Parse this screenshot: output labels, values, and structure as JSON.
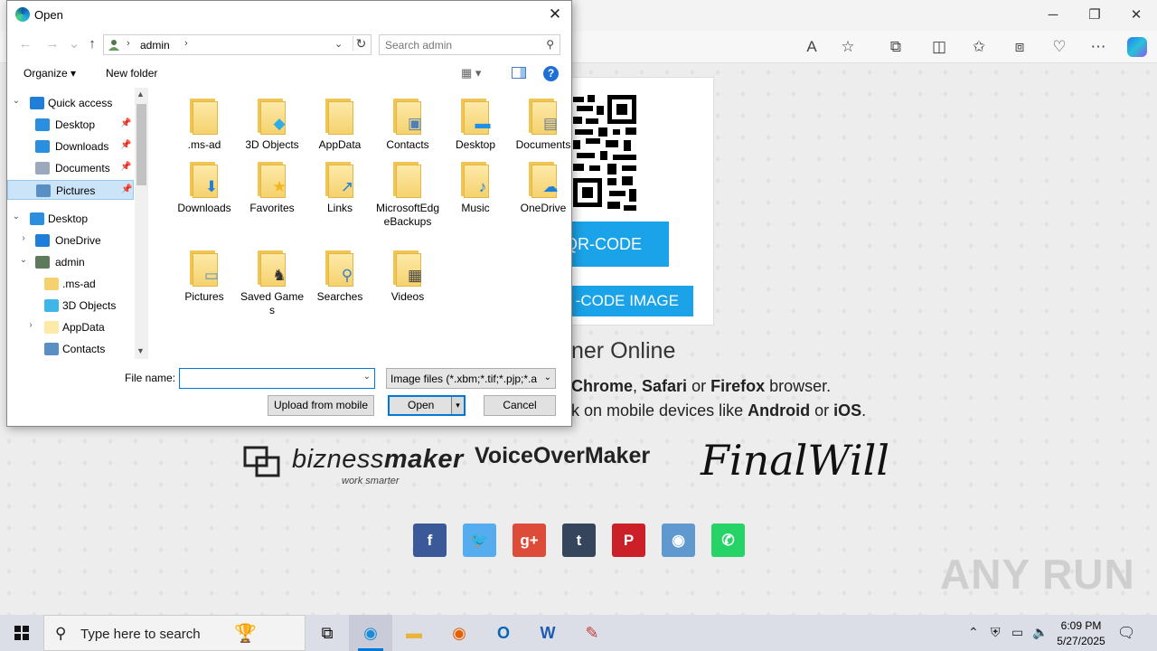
{
  "browser": {
    "window_controls": {
      "minimize": "─",
      "restore": "❐",
      "close": "✕"
    },
    "page": {
      "qr_button": "QR-CODE",
      "qr_image_button": "-CODE IMAGE",
      "headline": "ner Online",
      "para1": {
        "a": "Chrome",
        "b": ", ",
        "c": "Safari",
        "d": " or ",
        "e": "Firefox",
        "f": " browser."
      },
      "para2": {
        "a": "k on mobile devices like ",
        "b": "Android",
        "c": " or ",
        "d": "iOS",
        "e": "."
      },
      "logos": {
        "biznessmaker_a": "bizness",
        "biznessmaker_b": "maker",
        "biznessmaker_sub": "work smarter",
        "voiceovermaker": "VoiceOverMaker",
        "finalwill": "FinalWill"
      },
      "social": [
        {
          "name": "facebook",
          "glyph": "f",
          "color": "#3b5998"
        },
        {
          "name": "twitter",
          "glyph": "🐦",
          "color": "#55acee"
        },
        {
          "name": "google-plus",
          "glyph": "g+",
          "color": "#dd4b39"
        },
        {
          "name": "tumblr",
          "glyph": "t",
          "color": "#35465c"
        },
        {
          "name": "pinterest",
          "glyph": "P",
          "color": "#cb2027"
        },
        {
          "name": "reddit",
          "glyph": "◉",
          "color": "#5f99cf"
        },
        {
          "name": "whatsapp",
          "glyph": "✆",
          "color": "#25d366"
        }
      ]
    },
    "watermark": "ANY RUN"
  },
  "dialog": {
    "title": "Open",
    "address": {
      "segment": "admin"
    },
    "search_placeholder": "Search admin",
    "organize": "Organize ▾",
    "new_folder": "New folder",
    "help": "?",
    "tree": [
      {
        "label": "Quick access",
        "icon": "star-icon",
        "color": "#1e7fd8",
        "arrow": "⌄"
      },
      {
        "label": "Desktop",
        "icon": "desktop-icon",
        "color": "#2b8fe0",
        "pinned": true
      },
      {
        "label": "Downloads",
        "icon": "download-icon",
        "color": "#2b8fe0",
        "pinned": true
      },
      {
        "label": "Documents",
        "icon": "document-icon",
        "color": "#9aa9bb",
        "pinned": true
      },
      {
        "label": "Pictures",
        "icon": "pictures-icon",
        "color": "#5a8fc4",
        "pinned": true,
        "selected": true
      },
      {
        "label": "Desktop",
        "icon": "desktop-icon",
        "color": "#2b8fe0",
        "arrow": "⌄"
      },
      {
        "label": "OneDrive",
        "icon": "onedrive-icon",
        "color": "#1e7fd8",
        "arrow": "›"
      },
      {
        "label": "admin",
        "icon": "user-icon",
        "color": "#5d7a5a",
        "arrow": "⌄"
      },
      {
        "label": ".ms-ad",
        "icon": "folder-icon",
        "color": "#f5d26e"
      },
      {
        "label": "3D Objects",
        "icon": "3d-objects-icon",
        "color": "#3fb6e8"
      },
      {
        "label": "AppData",
        "icon": "folder-icon",
        "color": "#fde9a8",
        "arrow": "›"
      },
      {
        "label": "Contacts",
        "icon": "contacts-icon",
        "color": "#5a8fc4"
      }
    ],
    "files": [
      {
        "label": ".ms-ad",
        "badge": "",
        "badge_name": "folder-icon"
      },
      {
        "label": "3D Objects",
        "badge": "◆",
        "badge_name": "3d-objects-icon",
        "badge_color": "#2eaee6"
      },
      {
        "label": "AppData",
        "badge": "",
        "badge_name": "folder-icon"
      },
      {
        "label": "Contacts",
        "badge": "▣",
        "badge_name": "contacts-icon",
        "badge_color": "#4e7fb8"
      },
      {
        "label": "Desktop",
        "badge": "▬",
        "badge_name": "desktop-icon",
        "badge_color": "#1e90e6"
      },
      {
        "label": "Documents",
        "badge": "▤",
        "badge_name": "document-icon",
        "badge_color": "#6f7f92"
      },
      {
        "label": "Downloads",
        "badge": "⬇",
        "badge_name": "download-icon",
        "badge_color": "#1e7fd8"
      },
      {
        "label": "Favorites",
        "badge": "★",
        "badge_name": "star-icon",
        "badge_color": "#f2b51d"
      },
      {
        "label": "Links",
        "badge": "↗",
        "badge_name": "link-icon",
        "badge_color": "#1e7fd8"
      },
      {
        "label": "MicrosoftEdgeBackups",
        "badge": "",
        "badge_name": "folder-icon"
      },
      {
        "label": "Music",
        "badge": "♪",
        "badge_name": "music-icon",
        "badge_color": "#1e7fd8"
      },
      {
        "label": "OneDrive",
        "badge": "☁",
        "badge_name": "onedrive-icon",
        "badge_color": "#1e7fd8"
      },
      {
        "label": "Pictures",
        "badge": "▭",
        "badge_name": "pictures-icon",
        "badge_color": "#5a8fc4"
      },
      {
        "label": "Saved Games",
        "badge": "♞",
        "badge_name": "chess-icon",
        "badge_color": "#333333"
      },
      {
        "label": "Searches",
        "badge": "⚲",
        "badge_name": "search-icon",
        "badge_color": "#3b7fc9"
      },
      {
        "label": "Videos",
        "badge": "▦",
        "badge_name": "video-icon",
        "badge_color": "#444444"
      }
    ],
    "file_name_label": "File name:",
    "file_name_value": "",
    "file_type": "Image files (*.xbm;*.tif;*.pjp;*.a",
    "upload_button": "Upload from mobile",
    "open_button": "Open",
    "cancel_button": "Cancel"
  },
  "taskbar": {
    "search_placeholder": "Type here to search",
    "time": "6:09 PM",
    "date": "5/27/2025"
  }
}
